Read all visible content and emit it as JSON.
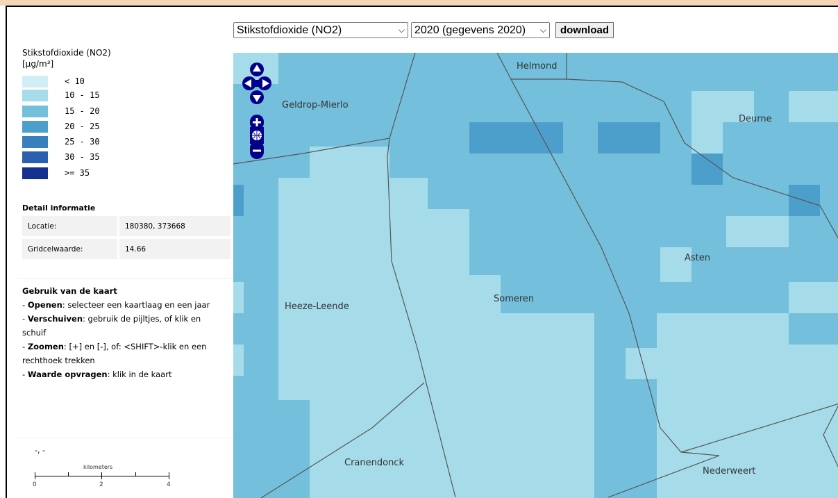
{
  "controls": {
    "layer_select": "Stikstofdioxide (NO2)",
    "year_select": "2020 (gegevens 2020)",
    "download_label": "download"
  },
  "legend": {
    "title_line1": "Stikstofdioxide (NO2)",
    "title_line2": "[µg/m³]",
    "classes": [
      {
        "label": "< 10",
        "color": "#d2eef5"
      },
      {
        "label": "10 - 15",
        "color": "#a6dcea"
      },
      {
        "label": "15 - 20",
        "color": "#74bfdb"
      },
      {
        "label": "20 - 25",
        "color": "#4d9fcb"
      },
      {
        "label": "25 - 30",
        "color": "#3a7fbd"
      },
      {
        "label": "30 - 35",
        "color": "#2b5faf"
      },
      {
        "label": ">= 35",
        "color": "#13308f"
      }
    ]
  },
  "detail": {
    "heading": "Detail informatie",
    "rows": [
      {
        "key": "Locatie:",
        "value": "180380, 373668"
      },
      {
        "key": "Gridcelwaarde:",
        "value": "14.66"
      }
    ]
  },
  "usage": {
    "heading": "Gebruik van de kaart",
    "items": [
      {
        "bold": "Openen",
        "text": ": selecteer een kaartlaag en een jaar"
      },
      {
        "bold": "Verschuiven",
        "text": ": gebruik de pijltjes, of klik en schuif"
      },
      {
        "bold": "Zoomen",
        "text": ": [+] en [-], of: <SHIFT>-klik en een rechthoek trekken"
      },
      {
        "bold": "Waarde opvragen",
        "text": ": klik in de kaart"
      }
    ]
  },
  "coords_readout": "-, -",
  "scale": {
    "label": "kilometers",
    "ticks": [
      "0",
      "2",
      "4"
    ]
  },
  "map": {
    "places": [
      "Helmond",
      "Geldrop-Mierlo",
      "Deurne",
      "Asten",
      "Heeze-Leende",
      "Someren",
      "Cranendonck",
      "Nederweert"
    ]
  }
}
